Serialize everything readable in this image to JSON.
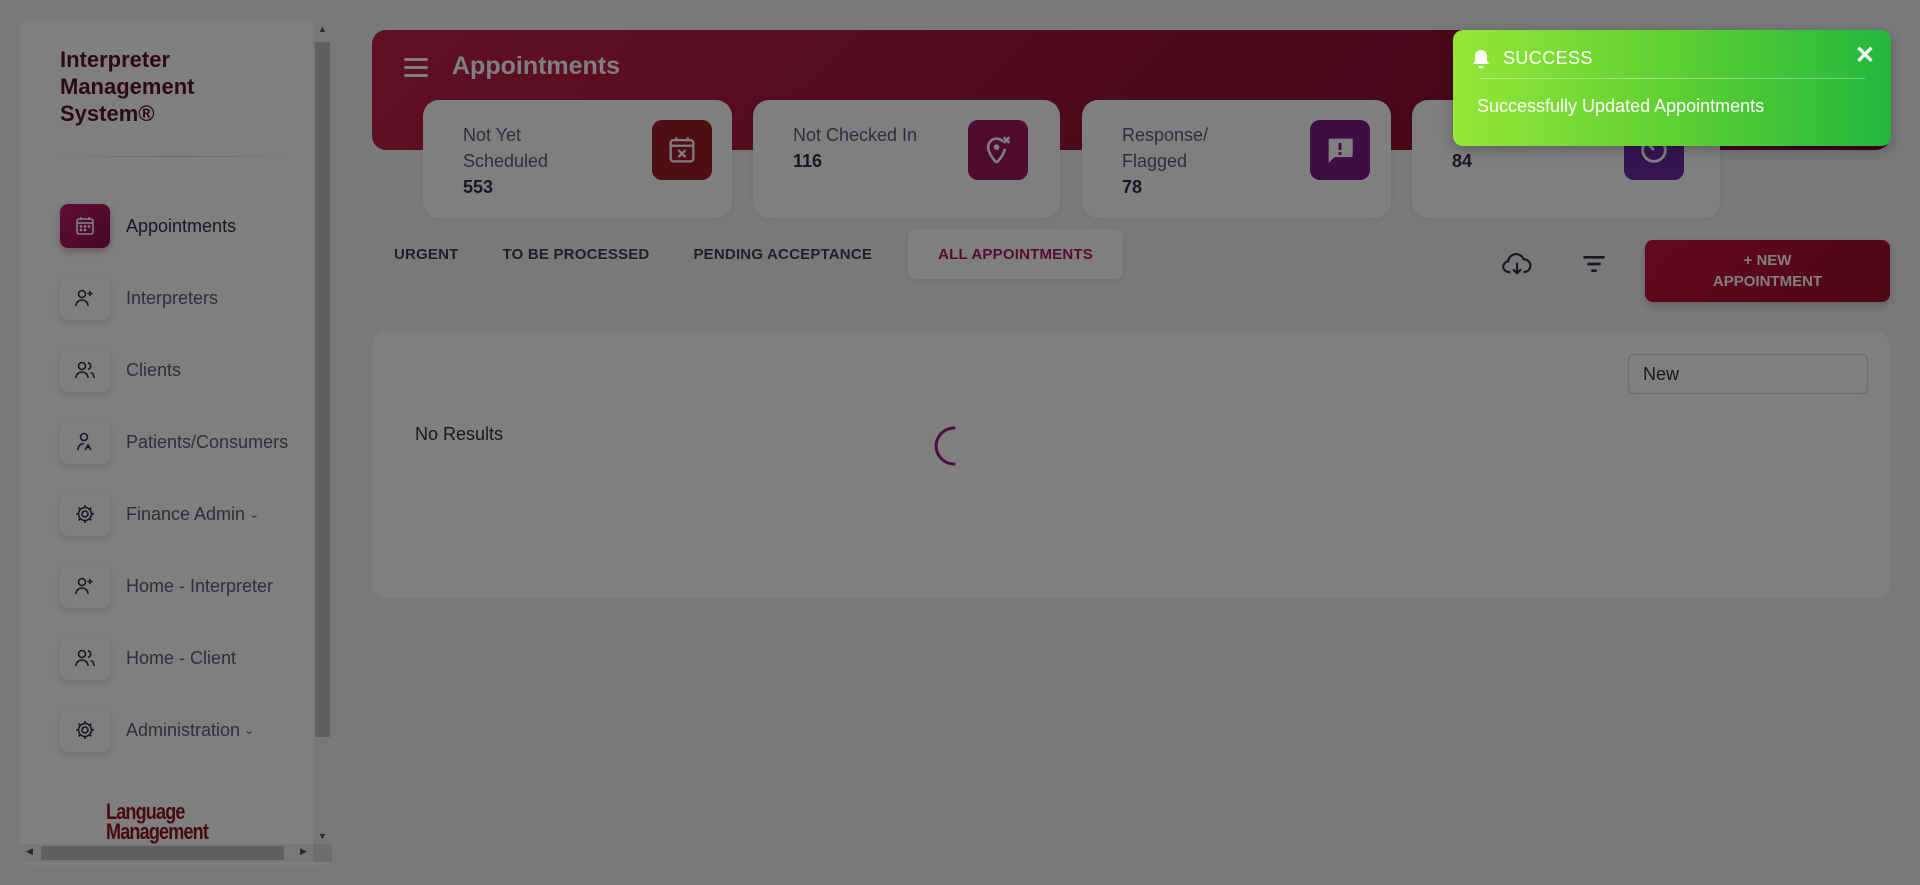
{
  "app": {
    "name": "Interpreter Management System®"
  },
  "sidebar": {
    "items": [
      {
        "label": "Appointments",
        "icon": "calendar-icon",
        "active": true
      },
      {
        "label": "Interpreters",
        "icon": "users-icon"
      },
      {
        "label": "Clients",
        "icon": "users-icon"
      },
      {
        "label": "Patients/Consumers",
        "icon": "person-icon"
      },
      {
        "label": "Finance Admin",
        "icon": "gear-icon",
        "caret": "⌄"
      },
      {
        "label": "Home - Interpreter",
        "icon": "users-icon"
      },
      {
        "label": "Home - Client",
        "icon": "users-icon"
      },
      {
        "label": "Administration",
        "icon": "gear-icon",
        "caret": "⌄"
      }
    ],
    "logo": {
      "line1": "Language",
      "line2": "Management"
    }
  },
  "header": {
    "title": "Appointments"
  },
  "stats": [
    {
      "label_line1": "Not Yet",
      "label_line2": "Scheduled",
      "count": "553",
      "icon": "calendar-x-icon",
      "color": "#9e1a2b"
    },
    {
      "label_line1": "Not Checked In",
      "count": "116",
      "icon": "location-x-icon",
      "color": "#a0145c"
    },
    {
      "label_line1": "Response/",
      "label_line2": "Flagged",
      "count": "78",
      "icon": "chat-alert-icon",
      "color": "#7d1a87"
    },
    {
      "count": "84",
      "icon": "clock-icon",
      "color": "#6a2ba0"
    }
  ],
  "tabs": [
    {
      "label": "URGENT"
    },
    {
      "label": "TO BE PROCESSED"
    },
    {
      "label": "PENDING ACCEPTANCE"
    },
    {
      "label": "ALL APPOINTMENTS",
      "active": true
    }
  ],
  "toolbar": {
    "new_label_line1": "+ NEW",
    "new_label_line2": "APPOINTMENT",
    "download_icon": "cloud-download-icon",
    "filter_icon": "filter-icon"
  },
  "content": {
    "filter_value": "New",
    "empty_text": "No Results"
  },
  "toast": {
    "title": "SUCCESS",
    "message": "Successfully Updated Appointments",
    "close": "✕"
  }
}
